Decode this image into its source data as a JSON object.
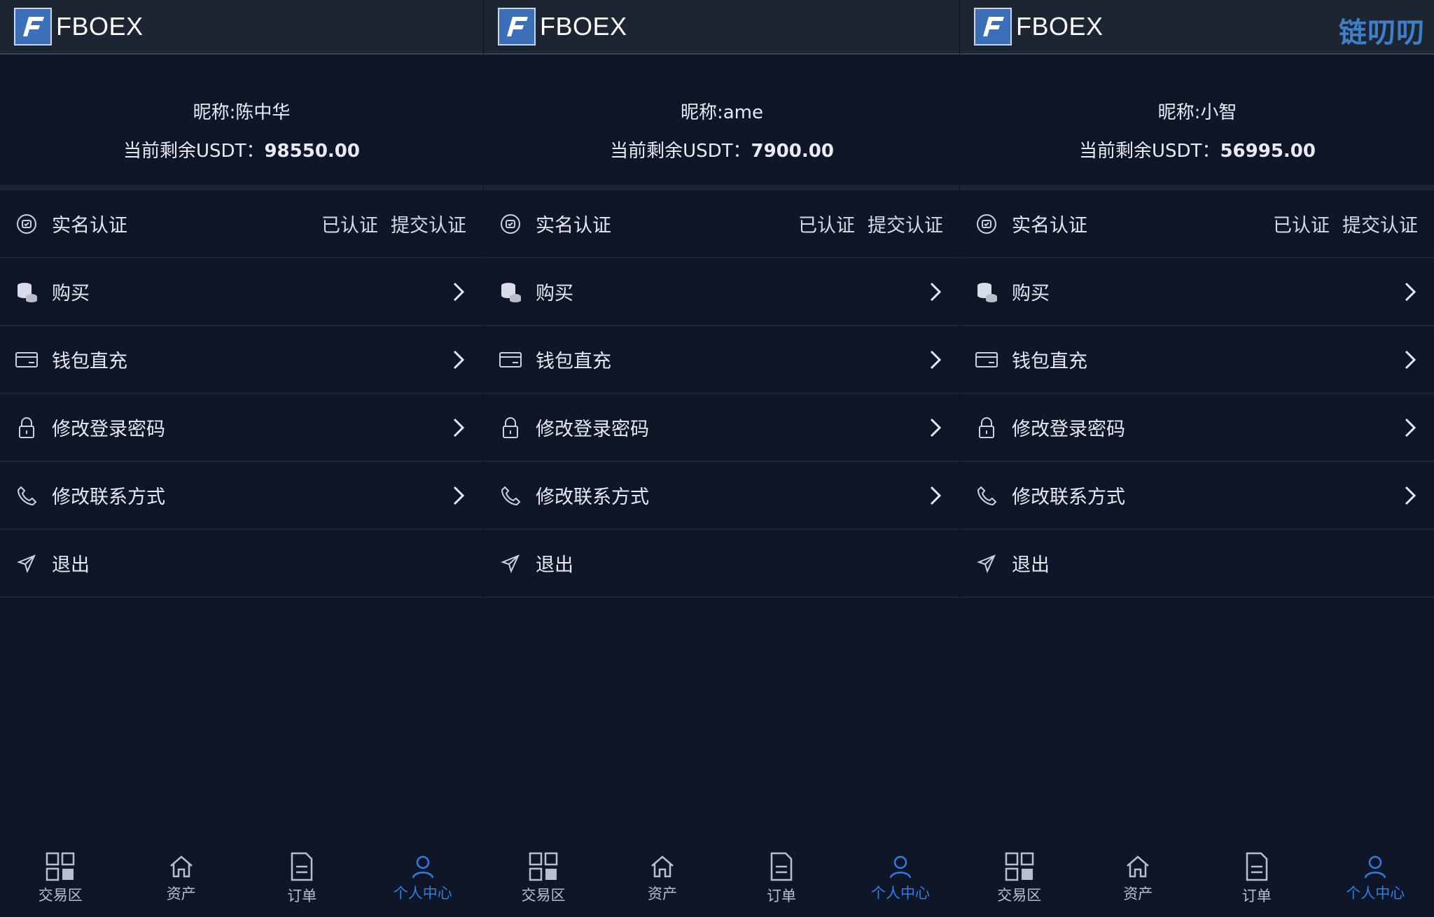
{
  "brand": {
    "name": "FBOEX",
    "watermark": "链叨叨"
  },
  "colors": {
    "background": "#0e1628",
    "topbar": "#1e2532",
    "accent": "#2f7ee5",
    "logo": "#3b6fb8"
  },
  "panels": [
    {
      "profile": {
        "nickname": "昵称:陈中华",
        "balance_label": "当前剩余USDT：",
        "balance_value": "98550.00"
      },
      "menu": {
        "verify": {
          "label": "实名认证",
          "status": "已认证",
          "action": "提交认证",
          "icon": "shield-icon"
        },
        "buy": {
          "label": "购买",
          "icon": "coins-icon"
        },
        "wallet": {
          "label": "钱包直充",
          "icon": "card-icon"
        },
        "password": {
          "label": "修改登录密码",
          "icon": "lock-icon"
        },
        "contact": {
          "label": "修改联系方式",
          "icon": "phone-icon"
        },
        "logout": {
          "label": "退出",
          "icon": "send-icon"
        }
      },
      "tabs": [
        {
          "label": "交易区",
          "icon": "grid-icon"
        },
        {
          "label": "资产",
          "icon": "home-icon"
        },
        {
          "label": "订单",
          "icon": "document-icon"
        },
        {
          "label": "个人中心",
          "icon": "user-icon",
          "active": true
        }
      ]
    },
    {
      "profile": {
        "nickname": "昵称:ame",
        "balance_label": "当前剩余USDT：",
        "balance_value": "7900.00"
      },
      "menu": {
        "verify": {
          "label": "实名认证",
          "status": "已认证",
          "action": "提交认证",
          "icon": "shield-icon"
        },
        "buy": {
          "label": "购买",
          "icon": "coins-icon"
        },
        "wallet": {
          "label": "钱包直充",
          "icon": "card-icon"
        },
        "password": {
          "label": "修改登录密码",
          "icon": "lock-icon"
        },
        "contact": {
          "label": "修改联系方式",
          "icon": "phone-icon"
        },
        "logout": {
          "label": "退出",
          "icon": "send-icon"
        }
      },
      "tabs": [
        {
          "label": "交易区",
          "icon": "grid-icon"
        },
        {
          "label": "资产",
          "icon": "home-icon"
        },
        {
          "label": "订单",
          "icon": "document-icon"
        },
        {
          "label": "个人中心",
          "icon": "user-icon",
          "active": true
        }
      ]
    },
    {
      "profile": {
        "nickname": "昵称:小智",
        "balance_label": "当前剩余USDT：",
        "balance_value": "56995.00"
      },
      "menu": {
        "verify": {
          "label": "实名认证",
          "status": "已认证",
          "action": "提交认证",
          "icon": "shield-icon"
        },
        "buy": {
          "label": "购买",
          "icon": "coins-icon"
        },
        "wallet": {
          "label": "钱包直充",
          "icon": "card-icon"
        },
        "password": {
          "label": "修改登录密码",
          "icon": "lock-icon"
        },
        "contact": {
          "label": "修改联系方式",
          "icon": "phone-icon"
        },
        "logout": {
          "label": "退出",
          "icon": "send-icon"
        }
      },
      "tabs": [
        {
          "label": "交易区",
          "icon": "grid-icon"
        },
        {
          "label": "资产",
          "icon": "home-icon"
        },
        {
          "label": "订单",
          "icon": "document-icon"
        },
        {
          "label": "个人中心",
          "icon": "user-icon",
          "active": true
        }
      ]
    }
  ]
}
